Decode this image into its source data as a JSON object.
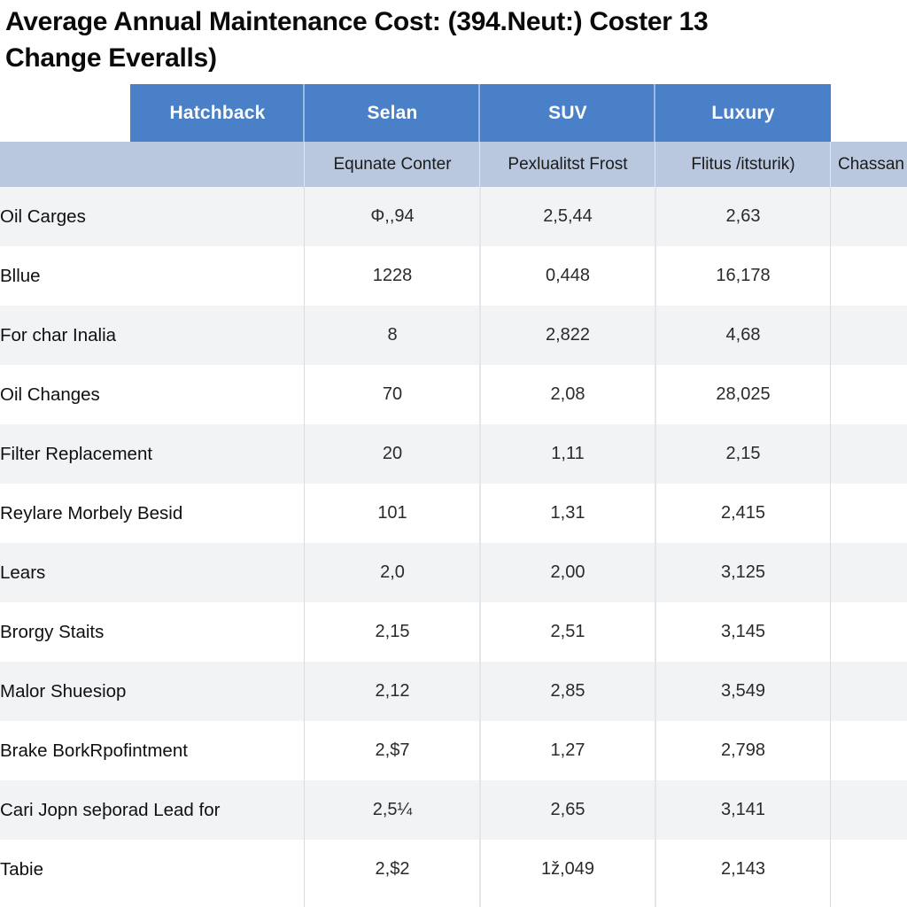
{
  "title": "Average Annual Maintenance Cost: (394.Neut:) Coster 13\nChange Everalls)",
  "theme": {
    "header_blue": "#4a80c8",
    "subheader_blue": "#b9c8de",
    "row_alt": "#f2f3f5",
    "row_base": "#ffffff",
    "text": "#151515"
  },
  "table": {
    "column_headers": [
      "Hatchback",
      "Selan",
      "SUV",
      "Luxury"
    ],
    "sub_headers": [
      "",
      "Equnate Conter",
      "Pexlualitst Frost",
      "Flitus /itsturik)",
      "Chassan"
    ],
    "rows": [
      {
        "label": "Oil Carges",
        "values": [
          "Φ,,94",
          "2,5,44",
          "2,63"
        ]
      },
      {
        "label": "Bllue",
        "values": [
          "1228",
          "0,448",
          "16,178"
        ]
      },
      {
        "label": "For char Inalia",
        "values": [
          "8",
          "2,822",
          "4,68"
        ]
      },
      {
        "label": "Oil Changes",
        "values": [
          "70",
          "2,08",
          "28,025"
        ]
      },
      {
        "label": "Filter Replacement",
        "values": [
          "20",
          "1,11",
          "2,15"
        ]
      },
      {
        "label": "Reylare Morbely Besid",
        "values": [
          "101",
          "1,31",
          "2,415"
        ]
      },
      {
        "label": "Lears",
        "values": [
          "2,0",
          "2,00",
          "3,125"
        ]
      },
      {
        "label": "Brorgy Staits",
        "values": [
          "2,15",
          "2,51",
          "3,145"
        ]
      },
      {
        "label": "Malor Shuesiop",
        "values": [
          "2,12",
          "2,85",
          "3,549"
        ]
      },
      {
        "label": "Brake BorkRpofintment",
        "values": [
          "2,$7",
          "1,27",
          "2,798"
        ]
      },
      {
        "label": "Cari Jopn seþorad Lead for",
        "values": [
          "2,5¼",
          "2,65",
          "3,141"
        ]
      },
      {
        "label": "Tabie",
        "values": [
          "2,$2",
          "1ž,049",
          "2,143"
        ]
      }
    ]
  }
}
